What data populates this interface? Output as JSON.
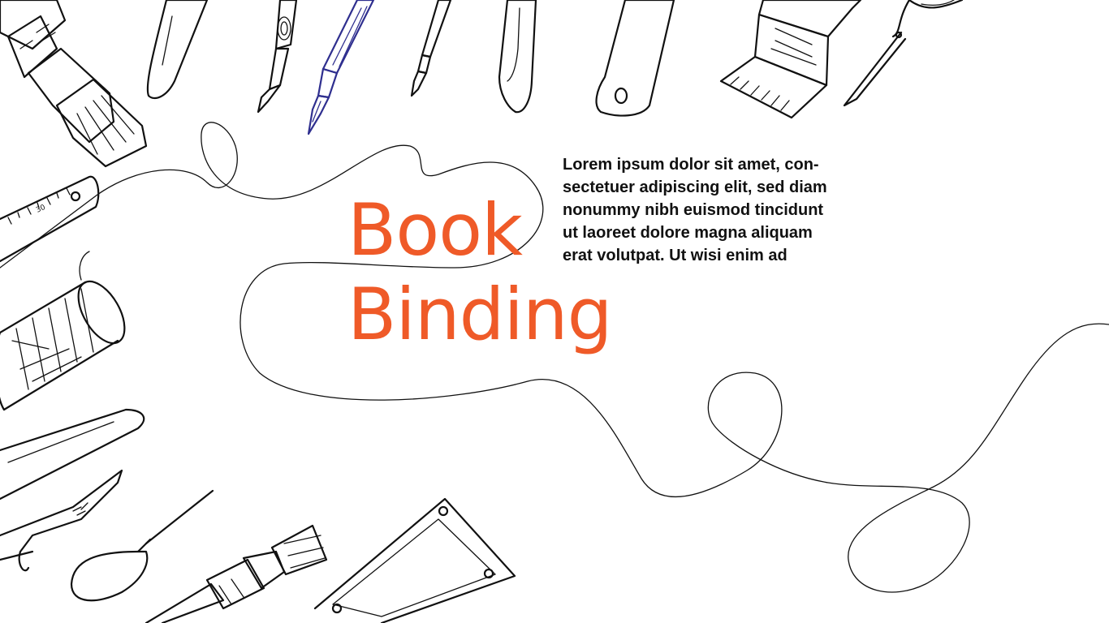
{
  "slide": {
    "title_line1": "Book",
    "title_line2": "Binding",
    "body_lines": [
      "Lorem ipsum dolor sit amet, con-",
      "sectetuer adipiscing elit, sed diam",
      "nonummy nibh euismod tincidunt",
      "ut laoreet dolore magna aliquam",
      "erat volutpat. Ut wisi enim ad"
    ],
    "ruler_mark": "30"
  },
  "colors": {
    "title": "#ef5a28",
    "text": "#111111",
    "line_art": "#111111",
    "pen_accent": "#2f2f8f",
    "background": "#ffffff"
  },
  "icons": [
    "paint-brush-icon",
    "bone-folder-icon",
    "scalpel-icon",
    "dip-pen-icon",
    "fine-brush-icon",
    "spatula-icon",
    "palette-knife-icon",
    "wide-brush-icon",
    "scissors-icon",
    "ruler-icon",
    "thread-spool-icon",
    "pliers-icon",
    "awl-icon",
    "glue-brush-icon",
    "book-press-frame-icon"
  ]
}
